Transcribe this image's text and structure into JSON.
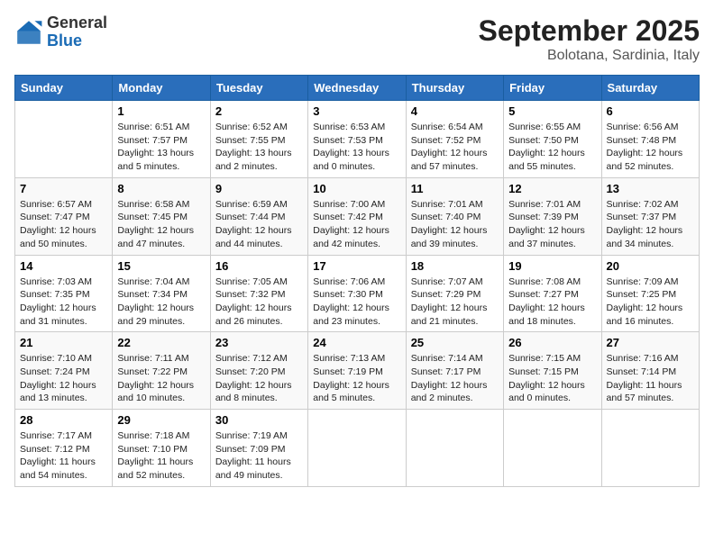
{
  "logo": {
    "general": "General",
    "blue": "Blue"
  },
  "header": {
    "month": "September 2025",
    "location": "Bolotana, Sardinia, Italy"
  },
  "weekdays": [
    "Sunday",
    "Monday",
    "Tuesday",
    "Wednesday",
    "Thursday",
    "Friday",
    "Saturday"
  ],
  "weeks": [
    [
      {
        "day": "",
        "sunrise": "",
        "sunset": "",
        "daylight": ""
      },
      {
        "day": "1",
        "sunrise": "Sunrise: 6:51 AM",
        "sunset": "Sunset: 7:57 PM",
        "daylight": "Daylight: 13 hours and 5 minutes."
      },
      {
        "day": "2",
        "sunrise": "Sunrise: 6:52 AM",
        "sunset": "Sunset: 7:55 PM",
        "daylight": "Daylight: 13 hours and 2 minutes."
      },
      {
        "day": "3",
        "sunrise": "Sunrise: 6:53 AM",
        "sunset": "Sunset: 7:53 PM",
        "daylight": "Daylight: 13 hours and 0 minutes."
      },
      {
        "day": "4",
        "sunrise": "Sunrise: 6:54 AM",
        "sunset": "Sunset: 7:52 PM",
        "daylight": "Daylight: 12 hours and 57 minutes."
      },
      {
        "day": "5",
        "sunrise": "Sunrise: 6:55 AM",
        "sunset": "Sunset: 7:50 PM",
        "daylight": "Daylight: 12 hours and 55 minutes."
      },
      {
        "day": "6",
        "sunrise": "Sunrise: 6:56 AM",
        "sunset": "Sunset: 7:48 PM",
        "daylight": "Daylight: 12 hours and 52 minutes."
      }
    ],
    [
      {
        "day": "7",
        "sunrise": "Sunrise: 6:57 AM",
        "sunset": "Sunset: 7:47 PM",
        "daylight": "Daylight: 12 hours and 50 minutes."
      },
      {
        "day": "8",
        "sunrise": "Sunrise: 6:58 AM",
        "sunset": "Sunset: 7:45 PM",
        "daylight": "Daylight: 12 hours and 47 minutes."
      },
      {
        "day": "9",
        "sunrise": "Sunrise: 6:59 AM",
        "sunset": "Sunset: 7:44 PM",
        "daylight": "Daylight: 12 hours and 44 minutes."
      },
      {
        "day": "10",
        "sunrise": "Sunrise: 7:00 AM",
        "sunset": "Sunset: 7:42 PM",
        "daylight": "Daylight: 12 hours and 42 minutes."
      },
      {
        "day": "11",
        "sunrise": "Sunrise: 7:01 AM",
        "sunset": "Sunset: 7:40 PM",
        "daylight": "Daylight: 12 hours and 39 minutes."
      },
      {
        "day": "12",
        "sunrise": "Sunrise: 7:01 AM",
        "sunset": "Sunset: 7:39 PM",
        "daylight": "Daylight: 12 hours and 37 minutes."
      },
      {
        "day": "13",
        "sunrise": "Sunrise: 7:02 AM",
        "sunset": "Sunset: 7:37 PM",
        "daylight": "Daylight: 12 hours and 34 minutes."
      }
    ],
    [
      {
        "day": "14",
        "sunrise": "Sunrise: 7:03 AM",
        "sunset": "Sunset: 7:35 PM",
        "daylight": "Daylight: 12 hours and 31 minutes."
      },
      {
        "day": "15",
        "sunrise": "Sunrise: 7:04 AM",
        "sunset": "Sunset: 7:34 PM",
        "daylight": "Daylight: 12 hours and 29 minutes."
      },
      {
        "day": "16",
        "sunrise": "Sunrise: 7:05 AM",
        "sunset": "Sunset: 7:32 PM",
        "daylight": "Daylight: 12 hours and 26 minutes."
      },
      {
        "day": "17",
        "sunrise": "Sunrise: 7:06 AM",
        "sunset": "Sunset: 7:30 PM",
        "daylight": "Daylight: 12 hours and 23 minutes."
      },
      {
        "day": "18",
        "sunrise": "Sunrise: 7:07 AM",
        "sunset": "Sunset: 7:29 PM",
        "daylight": "Daylight: 12 hours and 21 minutes."
      },
      {
        "day": "19",
        "sunrise": "Sunrise: 7:08 AM",
        "sunset": "Sunset: 7:27 PM",
        "daylight": "Daylight: 12 hours and 18 minutes."
      },
      {
        "day": "20",
        "sunrise": "Sunrise: 7:09 AM",
        "sunset": "Sunset: 7:25 PM",
        "daylight": "Daylight: 12 hours and 16 minutes."
      }
    ],
    [
      {
        "day": "21",
        "sunrise": "Sunrise: 7:10 AM",
        "sunset": "Sunset: 7:24 PM",
        "daylight": "Daylight: 12 hours and 13 minutes."
      },
      {
        "day": "22",
        "sunrise": "Sunrise: 7:11 AM",
        "sunset": "Sunset: 7:22 PM",
        "daylight": "Daylight: 12 hours and 10 minutes."
      },
      {
        "day": "23",
        "sunrise": "Sunrise: 7:12 AM",
        "sunset": "Sunset: 7:20 PM",
        "daylight": "Daylight: 12 hours and 8 minutes."
      },
      {
        "day": "24",
        "sunrise": "Sunrise: 7:13 AM",
        "sunset": "Sunset: 7:19 PM",
        "daylight": "Daylight: 12 hours and 5 minutes."
      },
      {
        "day": "25",
        "sunrise": "Sunrise: 7:14 AM",
        "sunset": "Sunset: 7:17 PM",
        "daylight": "Daylight: 12 hours and 2 minutes."
      },
      {
        "day": "26",
        "sunrise": "Sunrise: 7:15 AM",
        "sunset": "Sunset: 7:15 PM",
        "daylight": "Daylight: 12 hours and 0 minutes."
      },
      {
        "day": "27",
        "sunrise": "Sunrise: 7:16 AM",
        "sunset": "Sunset: 7:14 PM",
        "daylight": "Daylight: 11 hours and 57 minutes."
      }
    ],
    [
      {
        "day": "28",
        "sunrise": "Sunrise: 7:17 AM",
        "sunset": "Sunset: 7:12 PM",
        "daylight": "Daylight: 11 hours and 54 minutes."
      },
      {
        "day": "29",
        "sunrise": "Sunrise: 7:18 AM",
        "sunset": "Sunset: 7:10 PM",
        "daylight": "Daylight: 11 hours and 52 minutes."
      },
      {
        "day": "30",
        "sunrise": "Sunrise: 7:19 AM",
        "sunset": "Sunset: 7:09 PM",
        "daylight": "Daylight: 11 hours and 49 minutes."
      },
      {
        "day": "",
        "sunrise": "",
        "sunset": "",
        "daylight": ""
      },
      {
        "day": "",
        "sunrise": "",
        "sunset": "",
        "daylight": ""
      },
      {
        "day": "",
        "sunrise": "",
        "sunset": "",
        "daylight": ""
      },
      {
        "day": "",
        "sunrise": "",
        "sunset": "",
        "daylight": ""
      }
    ]
  ]
}
